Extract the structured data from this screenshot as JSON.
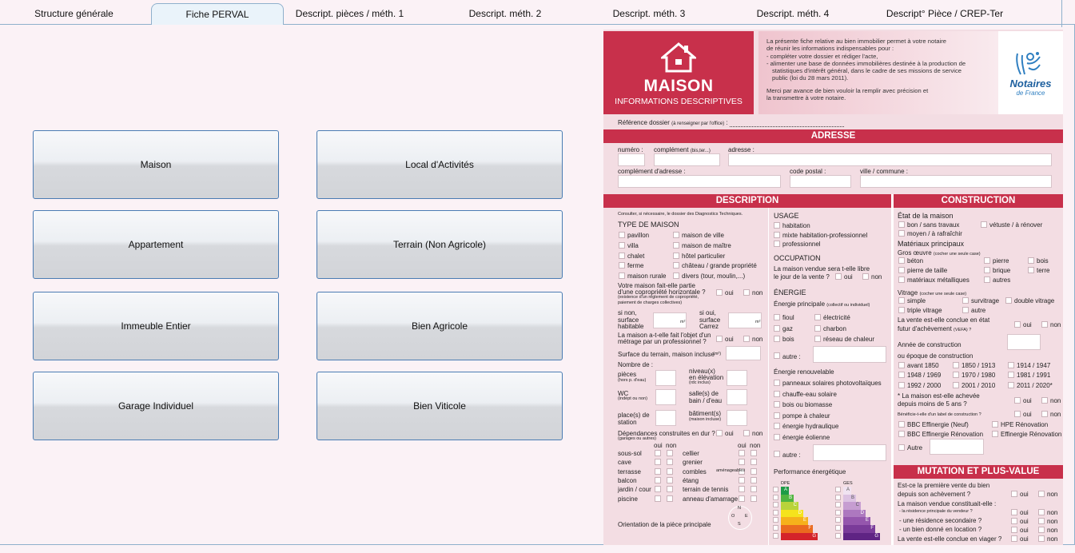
{
  "tabs": [
    "Structure générale",
    "Fiche PERVAL",
    "Descript. pièces / méth. 1",
    "Descript. méth. 2",
    "Descript. méth. 3",
    "Descript. méth. 4",
    "Descript° Pièce / CREP-Ter"
  ],
  "active_tab": "Fiche PERVAL",
  "property_buttons": [
    "Maison",
    "Local d'Activités",
    "Appartement",
    "Terrain (Non Agricole)",
    "Immeuble Entier",
    "Bien Agricole",
    "Garage Individuel",
    "Bien Viticole"
  ],
  "form": {
    "header": {
      "title": "MAISON",
      "subtitle": "INFORMATIONS DESCRIPTIVES",
      "intro": [
        "La présente fiche relative au bien immobilier permet à votre notaire",
        "de réunir les informations indispensables pour :",
        "- compléter votre dossier et rédiger l'acte,",
        "- alimenter une base de données immobilières destinée à la production de",
        "  statistiques d'intérêt général, dans le cadre de ses missions de service",
        "  public (loi du 28 mars 2011)."
      ],
      "thanks": [
        "Merci par avance de bien vouloir la remplir avec précision et",
        "la transmettre à votre notaire."
      ],
      "logo_line1": "Notaires",
      "logo_line2": "de France"
    },
    "reference_label": "Référence dossier",
    "reference_note": "(à renseigner par l'office)",
    "adresse": {
      "title": "ADRESSE",
      "numero": "numéro :",
      "complement": "complément",
      "complement_note": "(bis,ter...)",
      "adresse": "adresse :",
      "complement_adresse": "complément d'adresse :",
      "code_postal": "code postal :",
      "ville": "ville / commune :"
    },
    "description": {
      "title": "DESCRIPTION",
      "note": "Consulter, si nécessaire, le dossier des Diagnostics Techniques.",
      "type_title": "TYPE DE MAISON",
      "types_left": [
        "pavillon",
        "villa",
        "chalet",
        "ferme",
        "maison rurale"
      ],
      "types_right": [
        "maison de ville",
        "maison de maître",
        "hôtel particulier",
        "château / grande propriété",
        "divers (tour, moulin,...)"
      ],
      "copro_q": [
        "Votre maison fait-elle partie",
        "d'une copropriété horizontale ?"
      ],
      "copro_note": [
        "(existence d'un règlement de copropriété,",
        "paiement de charges collectives)"
      ],
      "si_non": [
        "si non,",
        "surface",
        "habitable"
      ],
      "si_oui": [
        "si oui,",
        "surface",
        "Carrez"
      ],
      "m2": "m²",
      "pro_q": [
        "La maison a-t-elle fait l'objet d'un",
        "métrage par un professionnel ?"
      ],
      "terrain": "Surface du terrain, maison incluse",
      "terrain_unit": "(m²)",
      "nombre": "Nombre de :",
      "pieces": "pièces",
      "pieces_note": "(hors p. d'eau)",
      "niveaux": [
        "niveau(x)",
        "en élévation"
      ],
      "niveaux_note": "(rdc inclus)",
      "wc": "WC",
      "wc_note": "(indépt ou non)",
      "salles": [
        "salle(s) de",
        "bain / d'eau"
      ],
      "places": [
        "place(s) de",
        "station"
      ],
      "batiments": "bâtiment(s)",
      "batiments_note": "(maison incluse)",
      "dependances": "Dépendances construites en dur ?",
      "dependances_note": "(garages ou autres)",
      "dep_left": [
        "sous-sol",
        "cave",
        "terrasse",
        "balcon",
        "jardin / cour",
        "piscine"
      ],
      "dep_right": [
        "cellier",
        "grenier",
        "combles",
        "étang",
        "terrain de tennis",
        "anneau d'amarrage"
      ],
      "combles_note": "aménageables",
      "orientation": "Orientation de la pièce principale",
      "compass": [
        "N",
        "O",
        "E",
        "S"
      ]
    },
    "usage": {
      "title": "USAGE",
      "items": [
        "habitation",
        "mixte habitation-professionnel",
        "professionnel"
      ],
      "occupation_title": "OCCUPATION",
      "occupation_q": [
        "La maison vendue sera t-elle libre",
        "le jour de la vente ?"
      ],
      "energie_title": "ÉNERGIE",
      "energie_principale": "Énergie principale",
      "energie_note": "(collectif ou individuel)",
      "energies_left": [
        "fioul",
        "gaz",
        "bois"
      ],
      "energies_right": [
        "électricité",
        "charbon",
        "réseau de chaleur"
      ],
      "autre": "autre :",
      "renouvelable_title": "Énergie renouvelable",
      "renouvelables": [
        "panneaux solaires photovoltaïques",
        "chauffe-eau solaire",
        "bois ou biomasse",
        "pompe à chaleur",
        "énergie hydraulique",
        "énergie éolienne"
      ],
      "perf_title": "Performance énergétique",
      "dpe": "DPE",
      "ges": "GES",
      "dpe_letters": [
        "A",
        "B",
        "C",
        "D",
        "E",
        "F",
        "G"
      ],
      "dpe_colors": [
        "#1e9b47",
        "#50b440",
        "#b9d33a",
        "#f5e31c",
        "#f6b11b",
        "#ea6a1f",
        "#d4232a"
      ],
      "ges_colors": [
        "#f0e3f1",
        "#dcc2e2",
        "#c69dd1",
        "#ad78bf",
        "#9556ad",
        "#7a3b99",
        "#5f2484"
      ]
    },
    "construction": {
      "title": "CONSTRUCTION",
      "etat_title": "État de la maison",
      "etats": [
        "bon / sans travaux",
        "vétuste / à rénover",
        "moyen / à rafraîchir"
      ],
      "materiaux_title": "Matériaux principaux",
      "gros_oeuvre": "Gros œuvre",
      "gros_oeuvre_note": "(cocher une seule case)",
      "materiaux": [
        "béton",
        "pierre",
        "bois",
        "pierre de taille",
        "brique",
        "terre",
        "matériaux métalliques",
        "autres"
      ],
      "vitrage": "Vitrage",
      "vitrage_note": "(cocher une seule case)",
      "vitrages": [
        "simple",
        "survitrage",
        "double vitrage",
        "triple vitrage",
        "autre"
      ],
      "vefa_q": [
        "La vente est-elle conclue en état",
        "futur d'achèvement"
      ],
      "vefa_note": "(VEFA) ?",
      "annee": "Année de construction",
      "epoque": "ou époque de construction",
      "epoques": [
        "avant 1850",
        "1850 / 1913",
        "1914 / 1947",
        "1948 / 1969",
        "1970 / 1980",
        "1981 / 1991",
        "1992 / 2000",
        "2001 / 2010",
        "2011 / 2020*"
      ],
      "achevee": [
        "* La maison est-elle achevée",
        "depuis moins de 5 ans ?"
      ],
      "label_q": "Bénéficie-t-elle d'un label de construction ?",
      "labels": [
        "BBC Effinergie (Neuf)",
        "HPE Rénovation",
        "BBC Effinergie Rénovation",
        "Effinergie Rénovation"
      ],
      "autre": "Autre"
    },
    "mutation": {
      "title": "MUTATION ET PLUS-VALUE",
      "premiere": [
        "Est-ce la première vente du bien",
        "depuis son achèvement ?"
      ],
      "constituait": "La maison vendue constituait-elle :",
      "options": [
        "- la résidence principale du vendeur ?",
        "- une résidence secondaire ?",
        "- un bien donné en location ?"
      ],
      "viager": "La vente est-elle conclue en viager ?"
    },
    "oui": "oui",
    "non": "non"
  }
}
